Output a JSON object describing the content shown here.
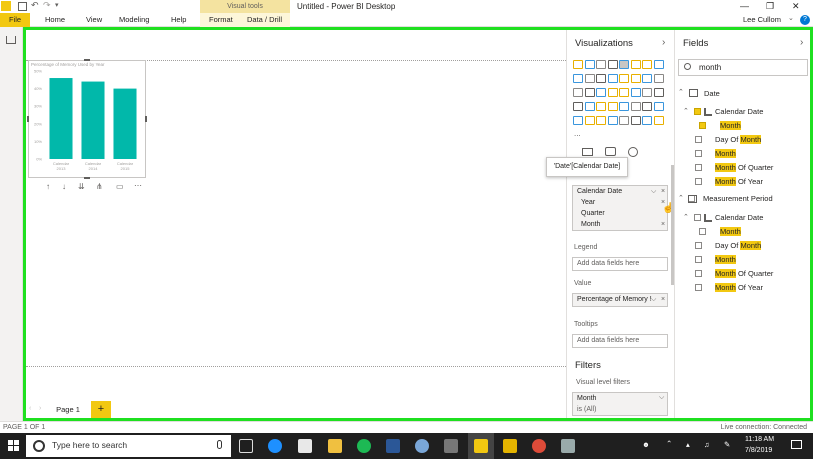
{
  "window": {
    "title": "Untitled - Power BI Desktop",
    "context_tab_group": "Visual tools",
    "user": "Lee Cullom",
    "help_glyph": "?"
  },
  "ribbon": {
    "tabs": [
      "File",
      "Home",
      "View",
      "Modeling",
      "Help",
      "Format",
      "Data / Drill"
    ]
  },
  "chart": {
    "title": "Percentage of Memory Used by Year",
    "bar_color": "#01b8aa"
  },
  "chart_data": {
    "type": "bar",
    "title": "Percentage of Memory Used by Year",
    "categories": [
      "Calendar 2013",
      "Calendar 2014",
      "Calendar 2015"
    ],
    "category_lines": [
      [
        "Calendar",
        "2013"
      ],
      [
        "Calendar",
        "2014"
      ],
      [
        "Calendar",
        "2015"
      ]
    ],
    "values": [
      46,
      44,
      40
    ],
    "y_ticks": [
      "0%",
      "10%",
      "20%",
      "30%",
      "40%",
      "50%"
    ],
    "ylim": [
      0,
      50
    ],
    "grid": false
  },
  "pages": {
    "current": "Page 1",
    "add_label": "+"
  },
  "visualizations": {
    "title": "Visualizations",
    "more": "...",
    "tooltip": "'Date'[Calendar Date]",
    "axis_field": {
      "name": "Calendar Date",
      "levels": [
        "Year",
        "Quarter",
        "Month"
      ]
    },
    "legend": {
      "label": "Legend",
      "placeholder": "Add data fields here"
    },
    "value": {
      "label": "Value",
      "field": "Percentage of Memory !"
    },
    "tooltips": {
      "label": "Tooltips",
      "placeholder": "Add data fields here"
    },
    "filters": {
      "title": "Filters",
      "visual_level": "Visual level filters",
      "filter_field": "Month",
      "filter_state": "is (All)"
    }
  },
  "fields": {
    "title": "Fields",
    "search_value": "month",
    "tables": [
      {
        "name": "Date",
        "hierarchy": "Calendar Date",
        "hierarchy_child": "Month",
        "items": [
          {
            "pre": "Day Of ",
            "hl": "Month",
            "post": ""
          },
          {
            "pre": "",
            "hl": "Month",
            "post": ""
          },
          {
            "pre": "",
            "hl": "Month",
            "post": " Of Quarter"
          },
          {
            "pre": "",
            "hl": "Month",
            "post": " Of Year"
          }
        ]
      },
      {
        "name": "Measurement Period",
        "hierarchy": "Calendar Date",
        "hierarchy_child": "Month",
        "items": [
          {
            "pre": "Day Of ",
            "hl": "Month",
            "post": ""
          },
          {
            "pre": "",
            "hl": "Month",
            "post": ""
          },
          {
            "pre": "",
            "hl": "Month",
            "post": " Of Quarter"
          },
          {
            "pre": "",
            "hl": "Month",
            "post": " Of Year"
          }
        ]
      }
    ]
  },
  "status": {
    "page": "PAGE 1 OF 1",
    "connection": "Live connection: Connected"
  },
  "taskbar": {
    "search_placeholder": "Type here to search",
    "time": "11:18 AM",
    "date": "7/8/2019"
  },
  "colors": {
    "accent": "#f2c811",
    "highlight_border": "#1fe020",
    "bar": "#01b8aa"
  }
}
